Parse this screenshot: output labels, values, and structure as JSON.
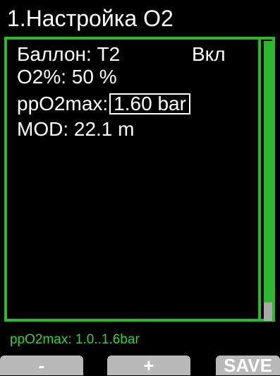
{
  "header": {
    "title": "1.Настройка О2"
  },
  "main": {
    "rows": [
      {
        "label": "Баллон: T2",
        "status": "Вкл"
      },
      {
        "label": "O2%: 50 %"
      },
      {
        "label": "ppO2max:",
        "value": "1.60 bar"
      },
      {
        "label": "MOD:  22.1 m"
      }
    ]
  },
  "hint": {
    "text": "ppO2max: 1.0..1.6bar"
  },
  "softkeys": {
    "minus": "-",
    "plus": "+",
    "save": "SAVE"
  },
  "colors": {
    "accent": "#2cb82c",
    "hint": "#39d039",
    "softkey": "#b9b9b9",
    "background": "#000000",
    "text": "#ffffff"
  }
}
